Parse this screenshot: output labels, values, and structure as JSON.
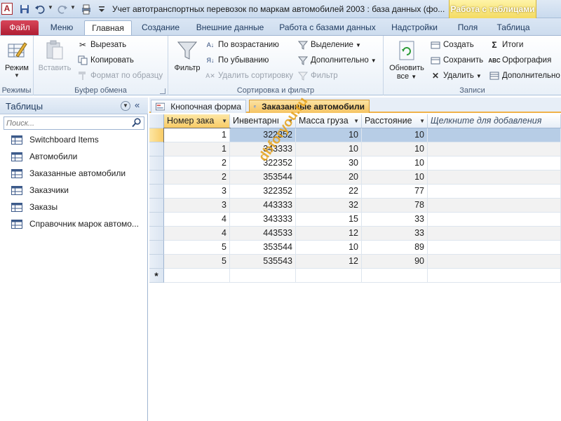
{
  "window": {
    "title": "Учет автотранспортных перевозок по маркам автомобилей 2003 : база данных (фо...",
    "context_tab": "Работа с таблицами",
    "app_icon": "A"
  },
  "ribbon_tabs": [
    "Файл",
    "Меню",
    "Главная",
    "Создание",
    "Внешние данные",
    "Работа с базами данных",
    "Надстройки",
    "Поля",
    "Таблица"
  ],
  "ribbon": {
    "modes": {
      "label": "Режимы",
      "view": "Режим"
    },
    "clipboard": {
      "label": "Буфер обмена",
      "paste": "Вставить",
      "cut": "Вырезать",
      "copy": "Копировать",
      "format_painter": "Формат по образцу"
    },
    "sort_filter": {
      "label": "Сортировка и фильтр",
      "filter": "Фильтр",
      "ascending": "По возрастанию",
      "descending": "По убыванию",
      "remove_sort": "Удалить сортировку",
      "selection": "Выделение",
      "advanced": "Дополнительно",
      "toggle_filter": "Фильтр"
    },
    "records": {
      "label": "Записи",
      "refresh_line1": "Обновить",
      "refresh_line2": "все",
      "new": "Создать",
      "save": "Сохранить",
      "delete": "Удалить",
      "totals": "Итоги",
      "spelling": "Орфография",
      "more": "Дополнительно"
    }
  },
  "nav": {
    "title": "Таблицы",
    "search_placeholder": "Поиск...",
    "items": [
      "Switchboard Items",
      "Автомобили",
      "Заказанные автомобили",
      "Заказчики",
      "Заказы",
      "Справочник марок автомо..."
    ]
  },
  "doc_tabs": [
    "Кнопочная форма",
    "Заказанные автомобили"
  ],
  "table": {
    "columns": [
      "Номер зака",
      "Инвентарнı",
      "Масса груза",
      "Расстояние",
      "Щелкните для добавления"
    ],
    "rows": [
      [
        "1",
        "322352",
        "10",
        "10"
      ],
      [
        "1",
        "343333",
        "10",
        "10"
      ],
      [
        "2",
        "322352",
        "30",
        "10"
      ],
      [
        "2",
        "353544",
        "20",
        "10"
      ],
      [
        "3",
        "322352",
        "22",
        "77"
      ],
      [
        "3",
        "443333",
        "32",
        "78"
      ],
      [
        "4",
        "343333",
        "15",
        "33"
      ],
      [
        "4",
        "443533",
        "12",
        "33"
      ],
      [
        "5",
        "353544",
        "10",
        "89"
      ],
      [
        "5",
        "535543",
        "12",
        "90"
      ]
    ],
    "new_row_marker": "*"
  },
  "watermark": "dbforyou.ru"
}
